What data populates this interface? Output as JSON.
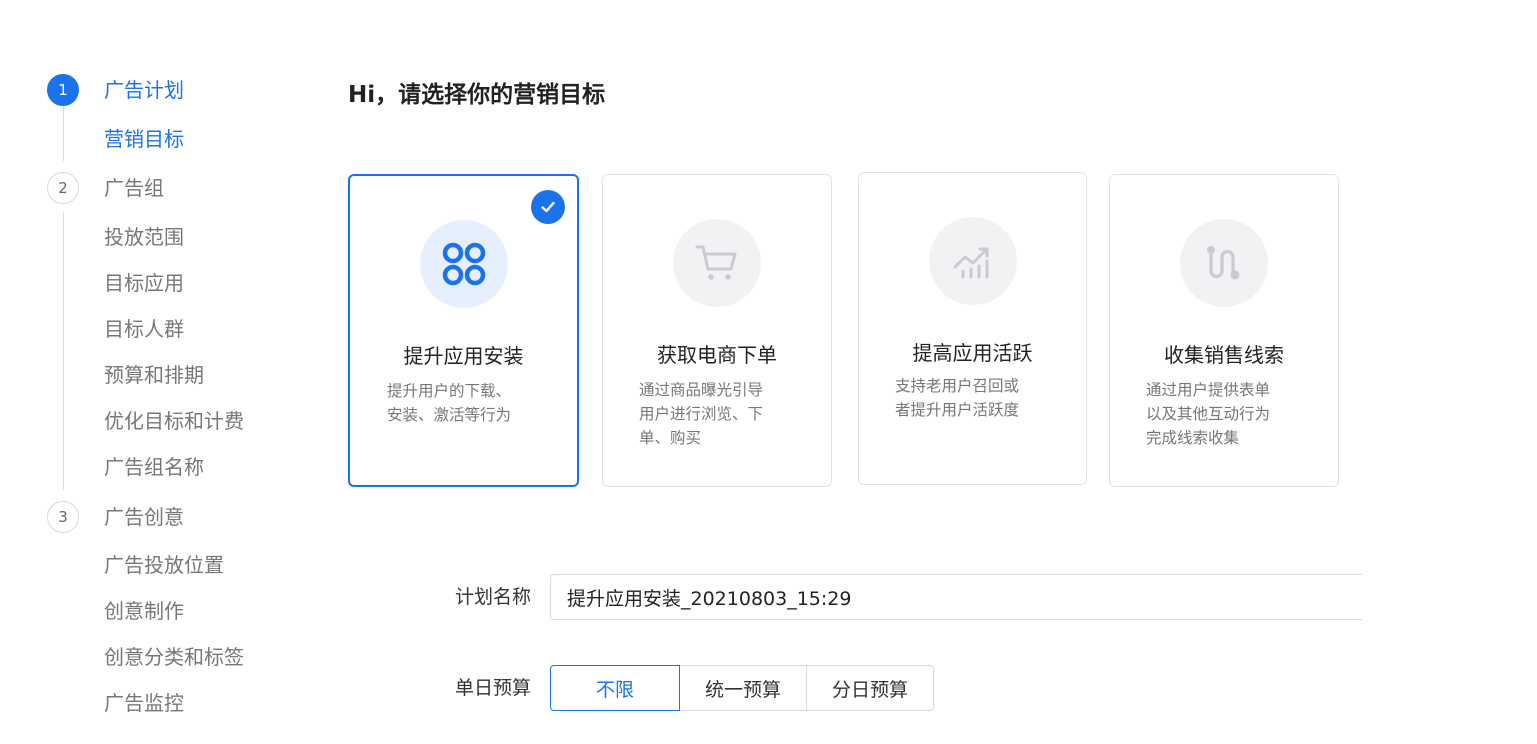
{
  "steps": [
    {
      "number": "1",
      "label": "广告计划",
      "active": true
    },
    {
      "number": "2",
      "label": "广告组",
      "active": false
    },
    {
      "number": "3",
      "label": "广告创意",
      "active": false
    }
  ],
  "nav": {
    "step1_items": [
      "营销目标"
    ],
    "step2_items": [
      "投放范围",
      "目标应用",
      "目标人群",
      "预算和排期",
      "优化目标和计费",
      "广告组名称"
    ],
    "step3_items": [
      "广告投放位置",
      "创意制作",
      "创意分类和标签",
      "广告监控"
    ]
  },
  "main": {
    "title": "Hi，请选择你的营销目标"
  },
  "cards": [
    {
      "title": "提升应用安装",
      "desc": [
        "提升用户的下载、",
        "安装、激活等行为"
      ],
      "icon": "app-grid-icon",
      "selected": true
    },
    {
      "title": "获取电商下单",
      "desc": [
        "通过商品曝光引导",
        "用户进行浏览、下",
        "单、购买"
      ],
      "icon": "shopping-cart-icon",
      "selected": false
    },
    {
      "title": "提高应用活跃",
      "desc": [
        "支持老用户召回或",
        "者提升用户活跃度"
      ],
      "icon": "trend-chart-icon",
      "selected": false
    },
    {
      "title": "收集销售线索",
      "desc": [
        "通过用户提供表单",
        "以及其他互动行为",
        "完成线索收集"
      ],
      "icon": "path-route-icon",
      "selected": false
    }
  ],
  "form": {
    "plan_name_label": "计划名称",
    "plan_name_value": "提升应用安装_20210803_15:29",
    "budget_label": "单日预算",
    "budget_options": [
      "不限",
      "统一预算",
      "分日预算"
    ],
    "budget_selected": "不限"
  },
  "colors": {
    "accent": "#1a73e8",
    "muted_icon": "#c9cbcf"
  }
}
